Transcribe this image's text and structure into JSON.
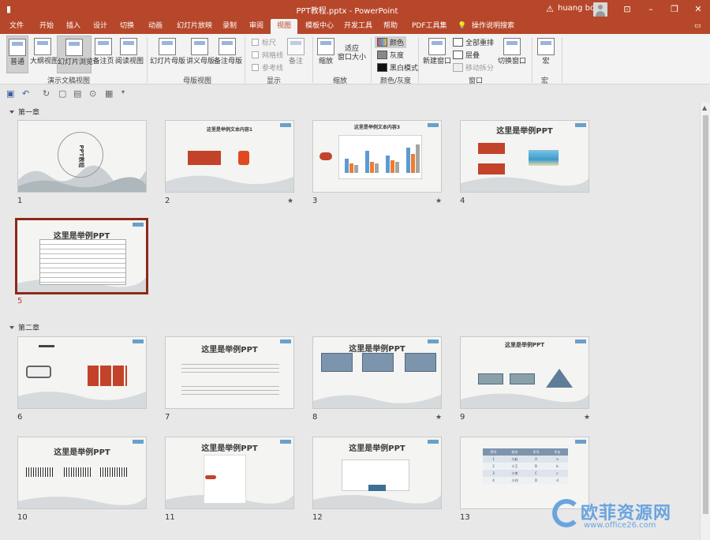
{
  "window": {
    "title": "PPT教程.pptx  -  PowerPoint",
    "user": "huang bo"
  },
  "tabs": [
    "文件",
    "开始",
    "插入",
    "设计",
    "切换",
    "动画",
    "幻灯片放映",
    "录制",
    "审阅",
    "视图",
    "模板中心",
    "开发工具",
    "帮助",
    "PDF工具集",
    "操作说明搜索"
  ],
  "active_tab": "视图",
  "ribbon": {
    "groups": [
      "演示文稿视图",
      "母版视图",
      "显示",
      "缩放",
      "颜色/灰度",
      "窗口",
      "宏"
    ],
    "pres_views": [
      "普通",
      "大纲视图",
      "幻灯片浏览",
      "备注页",
      "阅读视图"
    ],
    "master_views": [
      "幻灯片母版",
      "讲义母版",
      "备注母版"
    ],
    "show": {
      "ruler": "标尺",
      "gridlines": "网格线",
      "guides": "参考线",
      "notes": "备注"
    },
    "zoom": {
      "zoom": "缩放",
      "fit": "适应",
      "fit2": "窗口大小"
    },
    "color": {
      "color": "颜色",
      "gray": "灰度",
      "bw": "黑白模式"
    },
    "window": {
      "new": "新建窗口",
      "arrange": "全部重排",
      "cascade": "层叠",
      "split": "移动拆分",
      "switch": "切换窗口"
    },
    "macro": "宏"
  },
  "sections": [
    "第一章",
    "第二章"
  ],
  "slides": [
    {
      "n": "1",
      "title": "PPT教程",
      "star": ""
    },
    {
      "n": "2",
      "title": "这里是举例文本内容1",
      "star": "★"
    },
    {
      "n": "3",
      "title": "这里是举例文本内容3",
      "star": "★"
    },
    {
      "n": "4",
      "title": "这里是举例PPT",
      "star": ""
    },
    {
      "n": "5",
      "title": "这里是举例PPT",
      "star": ""
    },
    {
      "n": "6",
      "title": "",
      "star": ""
    },
    {
      "n": "7",
      "title": "这里是举例PPT",
      "star": ""
    },
    {
      "n": "8",
      "title": "这里是举例PPT",
      "star": "★"
    },
    {
      "n": "9",
      "title": "这里是举例PPT",
      "star": "★"
    },
    {
      "n": "10",
      "title": "这里是举例PPT",
      "star": ""
    },
    {
      "n": "11",
      "title": "这里是举例PPT",
      "star": ""
    },
    {
      "n": "12",
      "title": "这里是举例PPT",
      "star": ""
    },
    {
      "n": "13",
      "title": "",
      "star": ""
    }
  ],
  "slide13_table": {
    "headers": [
      "序号",
      "姓名",
      "学号",
      "专业"
    ],
    "rows": [
      [
        "1",
        "小赵",
        "A",
        "a"
      ],
      [
        "2",
        "小王",
        "B",
        "b"
      ],
      [
        "3",
        "小李",
        "C",
        "c"
      ],
      [
        "4",
        "小刘",
        "D",
        "d"
      ]
    ]
  },
  "watermark": {
    "text": "欧菲资源网",
    "url": "www.office26.com"
  }
}
